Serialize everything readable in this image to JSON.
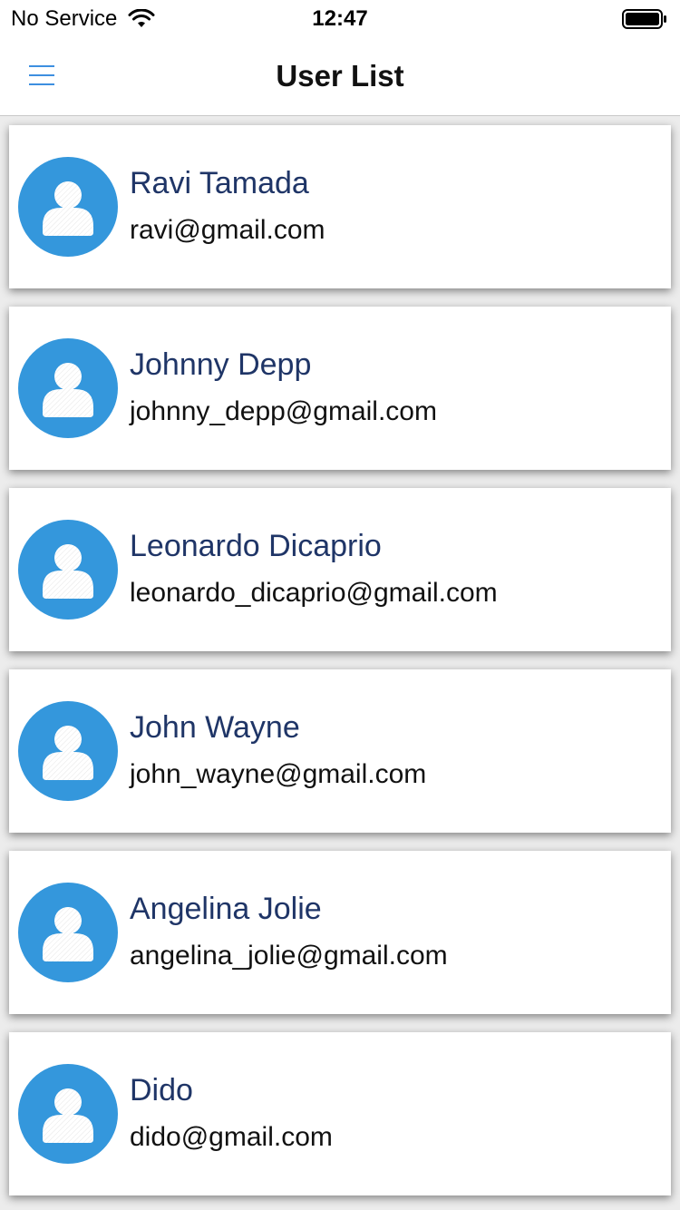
{
  "status_bar": {
    "carrier": "No Service",
    "time": "12:47",
    "wifi_icon": "wifi-icon",
    "battery_icon": "battery-icon"
  },
  "nav": {
    "title": "User List",
    "menu_icon": "hamburger-menu-icon",
    "accent_color": "#3d8fe0"
  },
  "colors": {
    "avatar_bg": "#3497dc",
    "name_text": "#1f3567",
    "list_bg": "#ececec"
  },
  "users": [
    {
      "name": "Ravi Tamada",
      "email": "ravi@gmail.com"
    },
    {
      "name": "Johnny Depp",
      "email": "johnny_depp@gmail.com"
    },
    {
      "name": "Leonardo Dicaprio",
      "email": "leonardo_dicaprio@gmail.com"
    },
    {
      "name": "John Wayne",
      "email": "john_wayne@gmail.com"
    },
    {
      "name": "Angelina Jolie",
      "email": "angelina_jolie@gmail.com"
    },
    {
      "name": "Dido",
      "email": "dido@gmail.com"
    }
  ]
}
